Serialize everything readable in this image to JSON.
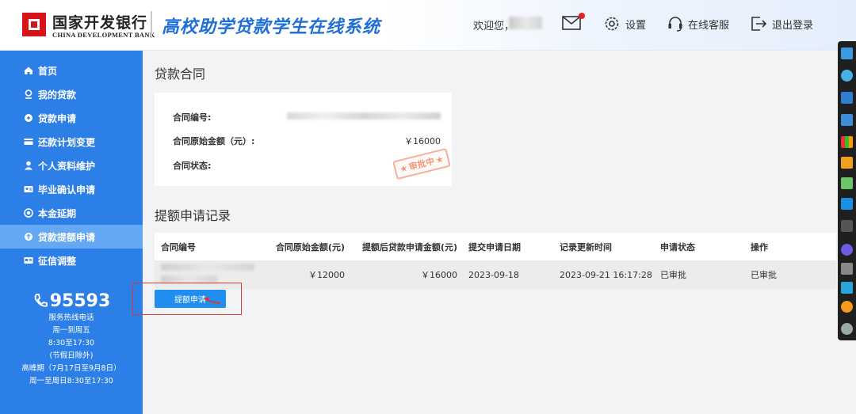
{
  "header": {
    "bank_name_cn": "国家开发银行",
    "bank_name_en": "CHINA DEVELOPMENT BANK",
    "system_title": "高校助学贷款学生在线系统",
    "welcome": "欢迎您，",
    "settings": "设置",
    "support": "在线客服",
    "logout": "退出登录",
    "brand_color": "#1f6fd8"
  },
  "sidebar": {
    "items": [
      {
        "label": "首页",
        "icon": "home-icon"
      },
      {
        "label": "我的贷款",
        "icon": "loan-icon"
      },
      {
        "label": "贷款申请",
        "icon": "apply-icon"
      },
      {
        "label": "还款计划变更",
        "icon": "card-icon"
      },
      {
        "label": "个人资料维护",
        "icon": "user-icon"
      },
      {
        "label": "毕业确认申请",
        "icon": "id-card-icon"
      },
      {
        "label": "本金延期",
        "icon": "target-icon"
      },
      {
        "label": "贷款提额申请",
        "icon": "raise-icon"
      },
      {
        "label": "征信调整",
        "icon": "credit-icon"
      }
    ],
    "active_index": 7,
    "hotline": {
      "number": "95593",
      "label": "服务热线电话",
      "days": "周一到周五",
      "hours": "8:30至17:30",
      "note": "(节假日除外)",
      "peak": "高峰期（7月17日至9月8日）",
      "peak_hours": "周一至周日8:30至17:30"
    },
    "color": "#2d7fe8"
  },
  "contract": {
    "section_title": "贷款合同",
    "id_label": "合同编号:",
    "amount_label": "合同原始金额（元）:",
    "amount_value": "￥16000",
    "status_label": "合同状态:",
    "stamp_text": "审批中"
  },
  "records": {
    "section_title": "提额申请记录",
    "columns": [
      "合同编号",
      "合同原始金额(元)",
      "提额后贷款申请金额(元)",
      "提交申请日期",
      "记录更新时间",
      "申请状态",
      "操作"
    ],
    "rows": [
      {
        "original_amount": "￥12000",
        "new_amount": "￥16000",
        "submit_date": "2023-09-18",
        "update_time": "2023-09-21 16:17:28",
        "status": "已审批",
        "action": "已审批"
      }
    ],
    "apply_button": "提额申请"
  }
}
